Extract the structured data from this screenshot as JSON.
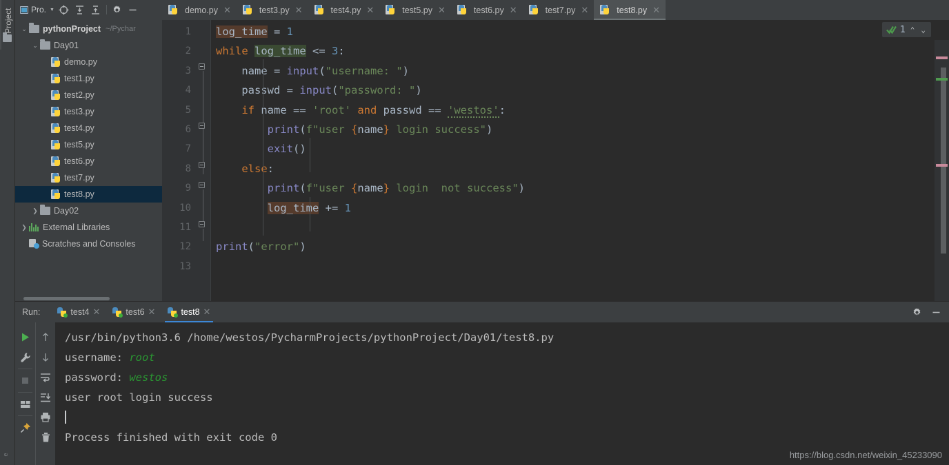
{
  "tool_strip": {
    "label": "Project",
    "folder_icon": "folder-icon",
    "bottom_label": "e"
  },
  "project_panel": {
    "toolbar": {
      "title": "Pro.",
      "icons": [
        "locate-icon",
        "expand-all-icon",
        "collapse-all-icon",
        "gear-icon",
        "minimize-icon"
      ]
    },
    "tree": [
      {
        "label": "pythonProject",
        "sub": "~/Pychar",
        "type": "folder",
        "depth": 0,
        "twisty": "down",
        "bold": true,
        "selected": false
      },
      {
        "label": "Day01",
        "sub": "",
        "type": "folder",
        "depth": 1,
        "twisty": "down",
        "bold": false,
        "selected": false
      },
      {
        "label": "demo.py",
        "sub": "",
        "type": "python",
        "depth": 2,
        "twisty": "none",
        "bold": false,
        "selected": false
      },
      {
        "label": "test1.py",
        "sub": "",
        "type": "python",
        "depth": 2,
        "twisty": "none",
        "bold": false,
        "selected": false
      },
      {
        "label": "test2.py",
        "sub": "",
        "type": "python",
        "depth": 2,
        "twisty": "none",
        "bold": false,
        "selected": false
      },
      {
        "label": "test3.py",
        "sub": "",
        "type": "python",
        "depth": 2,
        "twisty": "none",
        "bold": false,
        "selected": false
      },
      {
        "label": "test4.py",
        "sub": "",
        "type": "python",
        "depth": 2,
        "twisty": "none",
        "bold": false,
        "selected": false
      },
      {
        "label": "test5.py",
        "sub": "",
        "type": "python",
        "depth": 2,
        "twisty": "none",
        "bold": false,
        "selected": false
      },
      {
        "label": "test6.py",
        "sub": "",
        "type": "python",
        "depth": 2,
        "twisty": "none",
        "bold": false,
        "selected": false
      },
      {
        "label": "test7.py",
        "sub": "",
        "type": "python",
        "depth": 2,
        "twisty": "none",
        "bold": false,
        "selected": false
      },
      {
        "label": "test8.py",
        "sub": "",
        "type": "python",
        "depth": 2,
        "twisty": "none",
        "bold": false,
        "selected": true
      },
      {
        "label": "Day02",
        "sub": "",
        "type": "folder",
        "depth": 1,
        "twisty": "right",
        "bold": false,
        "selected": false
      },
      {
        "label": "External Libraries",
        "sub": "",
        "type": "libraries",
        "depth": 0,
        "twisty": "right",
        "bold": false,
        "selected": false
      },
      {
        "label": "Scratches and Consoles",
        "sub": "",
        "type": "scratches",
        "depth": 0,
        "twisty": "none",
        "bold": false,
        "selected": false
      }
    ]
  },
  "editor": {
    "tabs": [
      {
        "label": "demo.py",
        "active": false,
        "closable": true
      },
      {
        "label": "test3.py",
        "active": false,
        "closable": true
      },
      {
        "label": "test4.py",
        "active": false,
        "closable": true
      },
      {
        "label": "test5.py",
        "active": false,
        "closable": true
      },
      {
        "label": "test6.py",
        "active": false,
        "closable": true
      },
      {
        "label": "test7.py",
        "active": false,
        "closable": true
      },
      {
        "label": "test8.py",
        "active": true,
        "closable": true
      }
    ],
    "line_numbers": [
      "1",
      "2",
      "3",
      "4",
      "5",
      "6",
      "7",
      "8",
      "9",
      "10",
      "11",
      "12",
      "13"
    ],
    "code_lines": [
      "log_time = 1",
      "while log_time <= 3:",
      "    name = input(\"username: \")",
      "    passwd = input(\"password: \")",
      "    if name == 'root' and passwd == 'westos':",
      "        print(f\"user {name} login success\")",
      "        exit()",
      "    else:",
      "        print(f\"user {name} login  not success\")",
      "        log_time += 1",
      "",
      "print(\"error\")",
      ""
    ],
    "inspection": {
      "status_icon": "checkmark-icon",
      "count": "1",
      "up_arrow": "⌃",
      "down_arrow": "⌄"
    }
  },
  "run_panel": {
    "label": "Run:",
    "tabs": [
      {
        "label": "test4",
        "active": false
      },
      {
        "label": "test6",
        "active": false
      },
      {
        "label": "test8",
        "active": true
      }
    ],
    "header_icons": [
      "gear-icon",
      "minimize-icon"
    ],
    "side_icons_left": [
      "run-icon",
      "wrench-icon",
      "stop-icon",
      "layout-icon",
      "pin-icon"
    ],
    "side_icons_right": [
      "arrow-up-icon",
      "arrow-down-icon",
      "soft-wrap-icon",
      "scroll-to-end-icon",
      "print-icon",
      "trash-icon"
    ],
    "console": [
      {
        "text": "/usr/bin/python3.6 /home/westos/PycharmProjects/pythonProject/Day01/test8.py",
        "input": ""
      },
      {
        "text": "username: ",
        "input": "root"
      },
      {
        "text": "password: ",
        "input": "westos"
      },
      {
        "text": "user root login success",
        "input": ""
      },
      {
        "text": "",
        "input": "",
        "caret": true
      },
      {
        "text": "Process finished with exit code 0",
        "input": ""
      }
    ]
  },
  "watermark": "https://blog.csdn.net/weixin_45233090",
  "colors": {
    "bg_panel": "#3c3f41",
    "bg_editor": "#2b2b2b",
    "gutter": "#313335",
    "selection": "#0d293e",
    "accent_blue": "#3d87d6",
    "keyword": "#cc7832",
    "string": "#6a8759",
    "number": "#6897bb",
    "function": "#8888c6",
    "identifier": "#a9b7c6",
    "console_input": "#2a9632"
  }
}
